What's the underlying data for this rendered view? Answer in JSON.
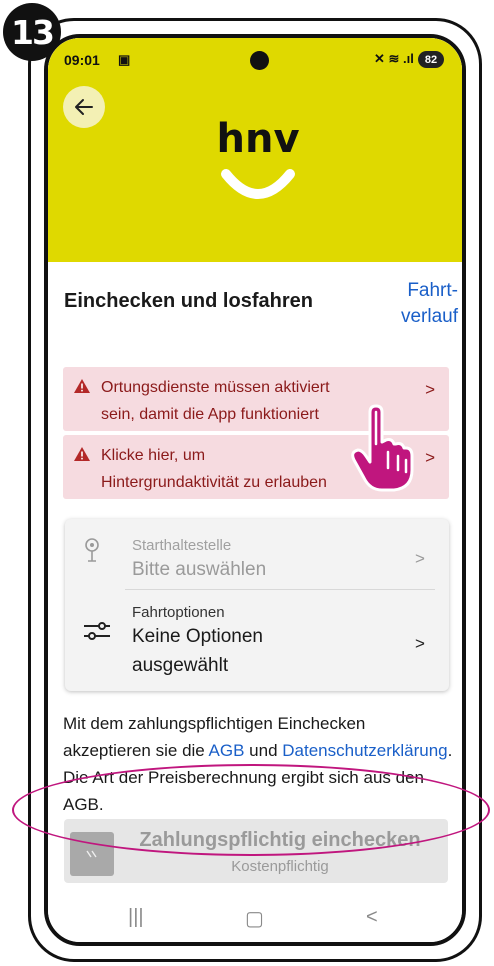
{
  "step_number": "13",
  "statusbar": {
    "time": "09:01",
    "rec_icon": "screen-record-icon",
    "battery": "82"
  },
  "header": {
    "logo_text": "hnv",
    "background": "#dfd900"
  },
  "page": {
    "title": "Einchecken und losfahren",
    "history_line1": "Fahrt-",
    "history_line2": "verlauf"
  },
  "alerts": [
    {
      "line1": "Ortungsdienste müssen aktiviert",
      "line2": "sein, damit die App funktioniert"
    },
    {
      "line1": "Klicke hier, um",
      "line2": "Hintergrundaktivität zu erlauben"
    }
  ],
  "trip": {
    "stop_label": "Starthaltestelle",
    "stop_value": "Bitte auswählen",
    "options_label": "Fahrtoptionen",
    "options_value_line1": "Keine Optionen",
    "options_value_line2": "ausgewählt"
  },
  "terms": {
    "before": "Mit dem zahlungspflichtigen Einchecken akzeptieren sie die ",
    "agb_link": "AGB",
    "middle": " und ",
    "privacy_link": "Datenschutzerklärung",
    "after": ". Die Art der Preisberechnung ergibt sich aus den AGB."
  },
  "checkin": {
    "label": "Zahlungspflichtig einchecken",
    "sublabel": "Kostenpflichtig"
  },
  "colors": {
    "accent": "#dfd900",
    "link": "#1a5fc8",
    "alert_bg": "#f6dbe0",
    "annotation": "#c0167e"
  }
}
